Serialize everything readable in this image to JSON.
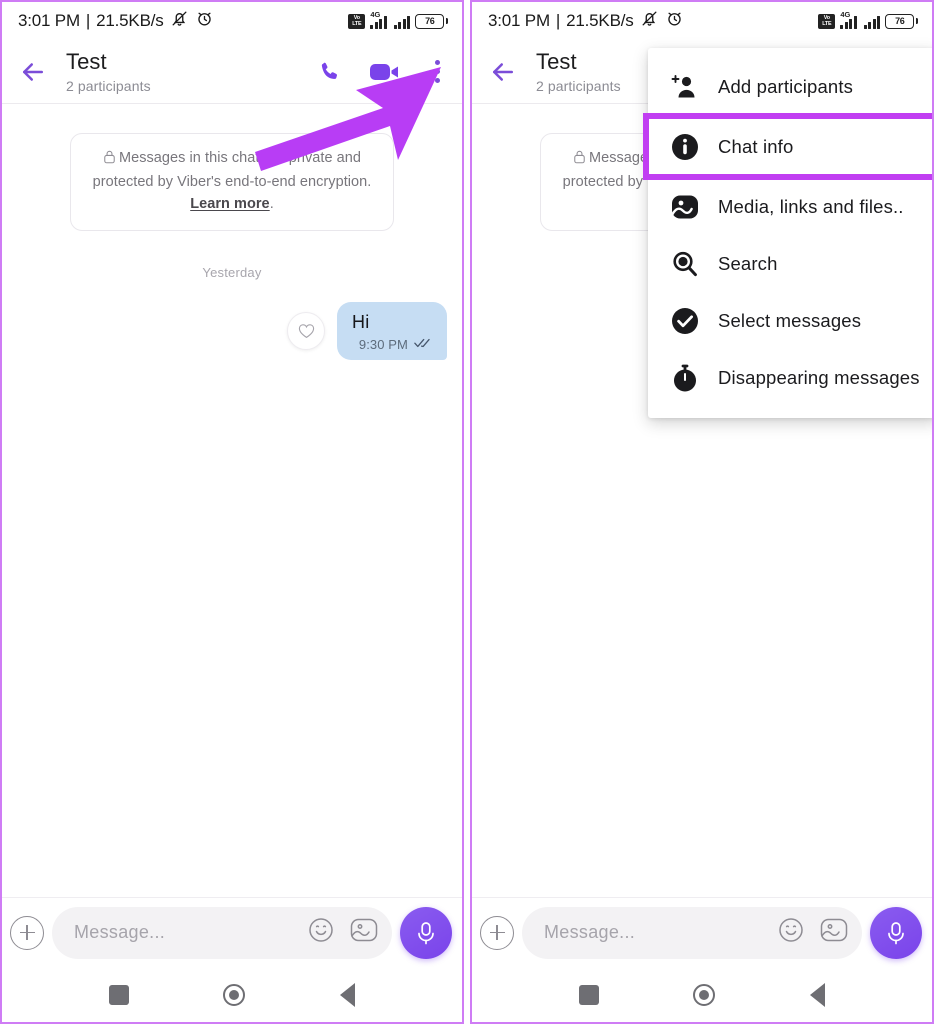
{
  "statusbar": {
    "time": "3:01 PM",
    "separator": "|",
    "network_speed": "21.5KB/s",
    "mute_icon": "bell-muted-icon",
    "alarm_icon": "alarm-clock-icon",
    "volte_label_top": "Vo",
    "volte_label_bottom": "LTE",
    "network_type": "4G",
    "battery_level": "76"
  },
  "header": {
    "back_icon": "back-arrow-icon",
    "title": "Test",
    "subtitle": "2 participants",
    "call_icon": "phone-call-icon",
    "video_icon": "video-call-icon",
    "menu_icon": "overflow-menu-icon"
  },
  "chat": {
    "encryption_notice": {
      "lock_icon": "lock-icon",
      "text_before_link": "Messages in this chat are private and protected by Viber's end-to-end encryption. ",
      "link_text": "Learn more",
      "text_after_link": "."
    },
    "day_divider": "Yesterday",
    "reaction_icon": "heart-reaction-icon",
    "message": {
      "text": "Hi",
      "time": "9:30 PM",
      "status_icon": "double-check-icon"
    }
  },
  "input_bar": {
    "attach_icon": "plus-attach-icon",
    "placeholder": "Message...",
    "emoji_icon": "smiley-emoji-icon",
    "sticker_icon": "sticker-image-icon",
    "mic_icon": "microphone-icon"
  },
  "navbar": {
    "recents_icon": "recents-square-icon",
    "home_icon": "home-circle-icon",
    "back_icon": "back-triangle-icon"
  },
  "annotation": {
    "arrow_color": "#b83df5",
    "highlight_color": "#c13ef2",
    "arrow_target": "overflow-menu-icon",
    "highlight_target": "Chat info"
  },
  "dropdown": {
    "items": [
      {
        "label": "Add participants",
        "icon": "add-person-icon",
        "highlighted": false
      },
      {
        "label": "Chat info",
        "icon": "info-circle-icon",
        "highlighted": true
      },
      {
        "label": "Media, links and files..",
        "icon": "media-image-icon",
        "highlighted": false
      },
      {
        "label": "Search",
        "icon": "search-magnifier-icon",
        "highlighted": false
      },
      {
        "label": "Select messages",
        "icon": "check-circle-icon",
        "highlighted": false
      },
      {
        "label": "Disappearing messages",
        "icon": "timer-stopwatch-icon",
        "highlighted": false
      }
    ]
  },
  "colors": {
    "accent_purple": "#7a43ea",
    "annotation_purple": "#b83df5",
    "bubble_blue": "#c6ddf3",
    "frame_border": "#cf7cf5"
  }
}
